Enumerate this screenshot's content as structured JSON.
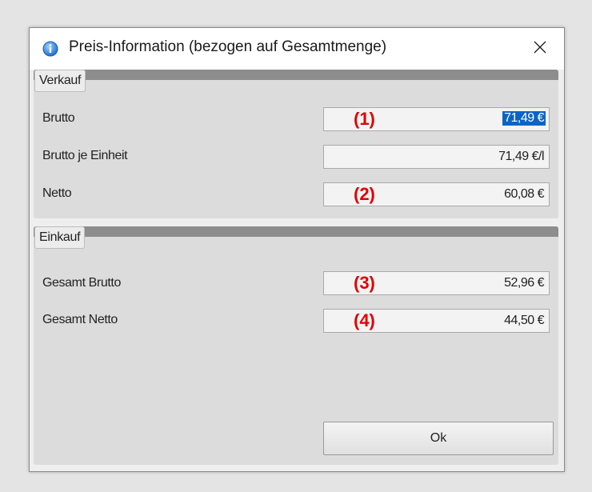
{
  "window": {
    "title": "Preis-Information (bezogen auf Gesamtmenge)",
    "close_icon": "close-icon",
    "info_icon": "info-icon"
  },
  "verkauf": {
    "header": "Verkauf",
    "rows": [
      {
        "label": "Brutto",
        "value": "71,49 €",
        "marker": "(1)",
        "selected": true
      },
      {
        "label": "Brutto je Einheit",
        "value": "71,49 €/l",
        "marker": ""
      },
      {
        "label": "Netto",
        "value": "60,08 €",
        "marker": "(2)"
      }
    ]
  },
  "einkauf": {
    "header": "Einkauf",
    "rows": [
      {
        "label": "Gesamt Brutto",
        "value": "52,96 €",
        "marker": "(3)"
      },
      {
        "label": "Gesamt Netto",
        "value": "44,50 €",
        "marker": "(4)"
      }
    ]
  },
  "buttons": {
    "ok": "Ok"
  },
  "colors": {
    "marker": "#e00000",
    "selection": "#0a64c8"
  }
}
